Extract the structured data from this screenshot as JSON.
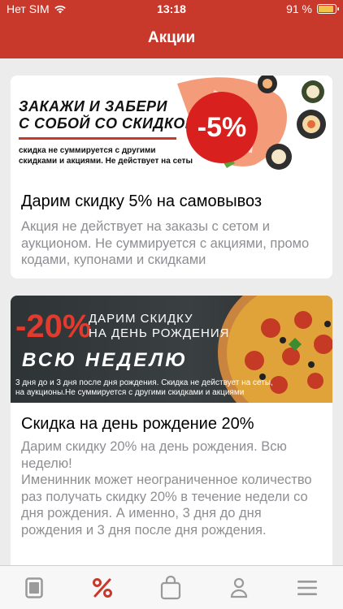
{
  "status": {
    "carrier": "Нет SIM",
    "time": "13:18",
    "battery": "91 %"
  },
  "header": {
    "title": "Акции"
  },
  "promos": [
    {
      "banner_headline_line1": "ЗАКАЖИ И ЗАБЕРИ",
      "banner_headline_line2": "С СОБОЙ СО СКИДКОЙ",
      "banner_badge": "-5%",
      "banner_note_line1": "скидка не суммируется с другими",
      "banner_note_line2": "скидками и акциями. Не действует на сеты",
      "title": "Дарим скидку 5% на самовывоз",
      "description": "Акция не действует на заказы с сетом и аукционом. Не суммируется с акциями, промо кодами, купонами и скидками"
    },
    {
      "banner_percent": "-20%",
      "banner_top_line1": "ДАРИМ СКИДКУ",
      "banner_top_line2": "НА ДЕНЬ РОЖДЕНИЯ",
      "banner_week": "ВСЮ НЕДЕЛЮ",
      "banner_note_line1": "3 дня до и 3 дня после дня рождения. Скидка не действует на сеты,",
      "banner_note_line2": "на аукционы.Не суммируется с другими скидками и акциями",
      "title": "Скидка на день рождение 20%",
      "description_line1": "Дарим скидку 20% на день рождения. Всю неделю!",
      "description_line2": "Именинник может неограниченное количество раз получать скидку 20% в течение недели со дня рождения. А именно, 3 дня до дня рождения и 3 дня после дня рождения."
    }
  ],
  "tabbar": {
    "items": [
      {
        "icon": "menu-book-icon",
        "active": false
      },
      {
        "icon": "percent-icon",
        "active": true
      },
      {
        "icon": "bag-icon",
        "active": false
      },
      {
        "icon": "profile-icon",
        "active": false
      },
      {
        "icon": "hamburger-icon",
        "active": false
      }
    ],
    "active_color": "#c8382b",
    "inactive_color": "#9a9a9a"
  }
}
